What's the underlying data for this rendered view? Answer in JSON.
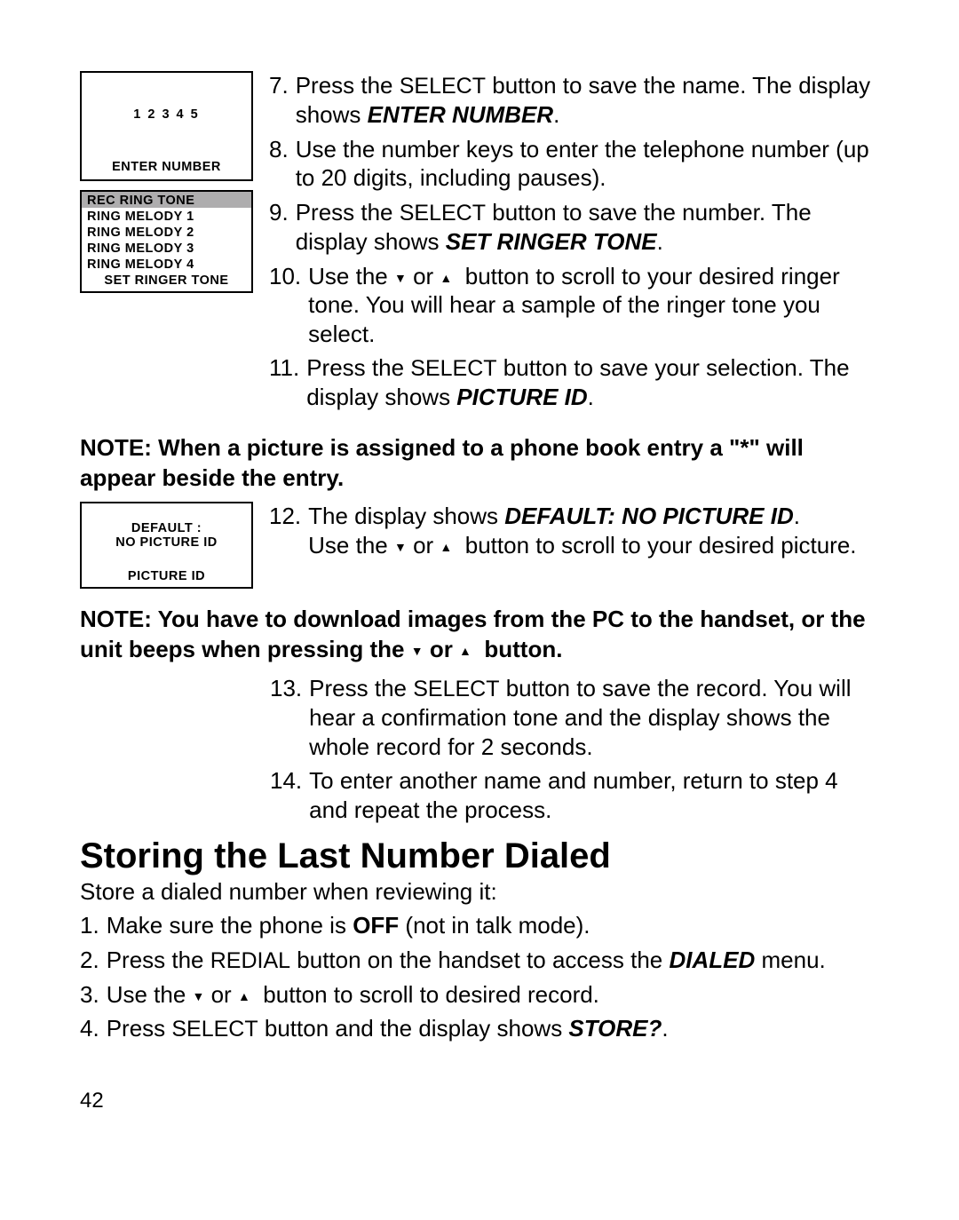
{
  "screen1": {
    "digits": "1 2 3 4 5",
    "footer": "ENTER NUMBER"
  },
  "screen2": {
    "items": [
      "REC RING TONE",
      "RING MELODY 1",
      "RING MELODY 2",
      "RING MELODY 3",
      "RING MELODY 4"
    ],
    "footer": "SET RINGER TONE"
  },
  "screen3": {
    "line1": "DEFAULT :",
    "line2": "NO PICTURE ID",
    "footer": "PICTURE ID"
  },
  "step7": {
    "num": "7.",
    "t1": "Press the ",
    "btn": "SELECT",
    "t2": " button to save the name. The display shows ",
    "kw": "ENTER NUMBER",
    "t3": "."
  },
  "step8": {
    "num": "8.",
    "t1": "Use the number keys to enter the telephone number (up to 20 digits, including pauses)."
  },
  "step9": {
    "num": "9.",
    "t1": "Press the ",
    "btn": "SELECT",
    "t2": " button to save the number. The display shows ",
    "kw": "SET RINGER TONE",
    "t3": "."
  },
  "step10": {
    "num": "10.",
    "t1": "Use the ",
    "t2": " or ",
    "t3": " button to scroll to your desired ringer tone. You will hear a sample of the ringer tone you select."
  },
  "step11": {
    "num": "11.",
    "t1": "Press the ",
    "btn": "SELECT",
    "t2": " button to save your selection. The display shows ",
    "kw": "PICTURE ID",
    "t3": "."
  },
  "note1": "NOTE: When a picture is assigned to a phone book entry a \"*\" will appear beside the entry.",
  "step12": {
    "num": "12.",
    "t1": "The display shows ",
    "kw": "DEFAULT: NO PICTURE ID",
    "t2": ".",
    "t3": "Use the ",
    "t4": " or ",
    "t5": " button to scroll to your desired picture."
  },
  "note2a": "NOTE: You have to download images from the PC to the handset, or the unit beeps when pressing the ",
  "note2b": " or ",
  "note2c": " button.",
  "step13": {
    "num": "13.",
    "t1": "Press the ",
    "btn": "SELECT",
    "t2": " button to save the record. You will hear a confirmation tone and the display shows the whole record for 2 seconds."
  },
  "step14": {
    "num": "14.",
    "t1": "To enter another name and number, return to step 4 and repeat the process."
  },
  "heading": "Storing the Last Number Dialed",
  "intro": "Store a dialed number when reviewing it:",
  "s1": {
    "num": "1.",
    "t1": "Make sure the phone is ",
    "kw": "OFF",
    "t2": " (not in talk mode)."
  },
  "s2": {
    "num": "2.",
    "t1": "Press the ",
    "btn": "REDIAL",
    "t2": " button on the handset to access the ",
    "kw": "DIALED",
    "t3": " menu."
  },
  "s3": {
    "num": "3.",
    "t1": "Use the ",
    "t2": " or ",
    "t3": " button to scroll to desired record."
  },
  "s4": {
    "num": "4.",
    "t1": "Press ",
    "btn": "SELECT",
    "t2": " button and the display shows ",
    "kw": "STORE?",
    "t3": "."
  },
  "pagenum": "42"
}
